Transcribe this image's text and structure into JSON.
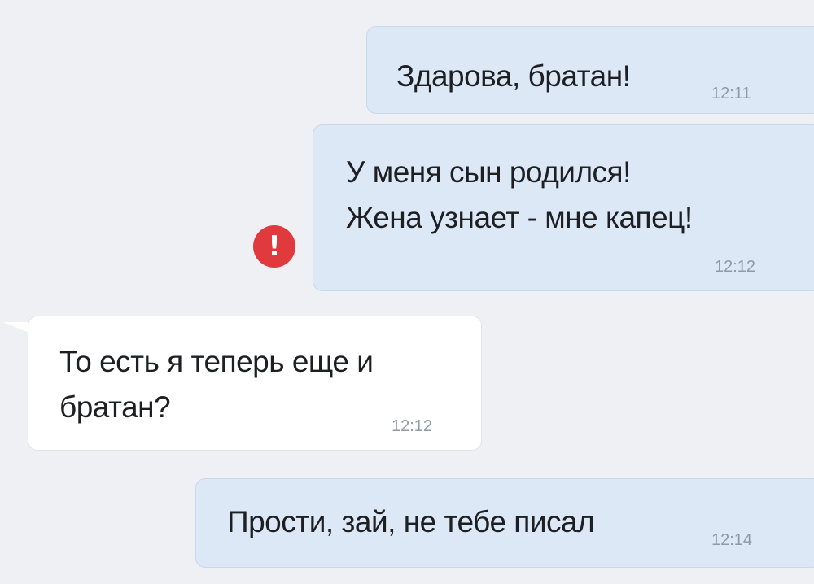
{
  "messages": [
    {
      "direction": "outgoing",
      "lines": [
        "Здарова, братан!"
      ],
      "time": "12:11"
    },
    {
      "direction": "outgoing",
      "lines": [
        "У меня сын родился!",
        "Жена узнает - мне капец!"
      ],
      "time": "12:12",
      "status_icon": "error-exclamation-icon"
    },
    {
      "direction": "incoming",
      "lines": [
        "То есть я теперь еще и",
        "братан?"
      ],
      "time": "12:12"
    },
    {
      "direction": "outgoing",
      "lines": [
        "Прости, зай, не тебе писал"
      ],
      "time": "12:14"
    }
  ],
  "error_icon_glyph": "!",
  "colors": {
    "background": "#eef0f3",
    "outgoing_bubble": "#dce8f6",
    "incoming_bubble": "#ffffff",
    "error_badge": "#e0393e",
    "timestamp": "#8e9aa8"
  }
}
